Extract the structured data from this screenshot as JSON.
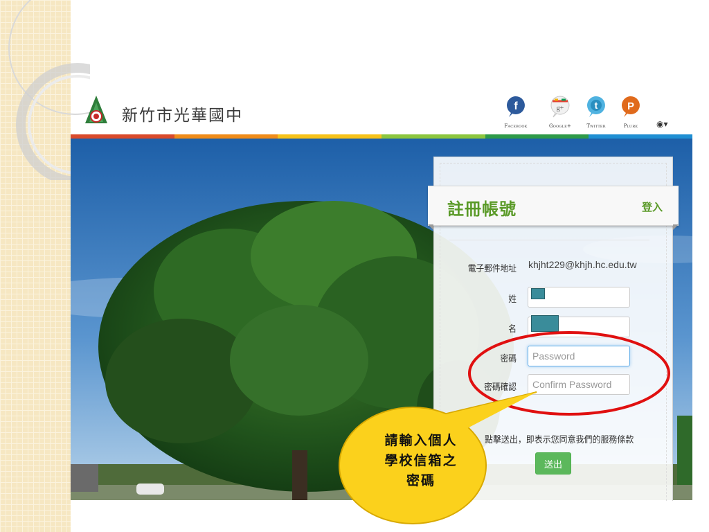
{
  "header": {
    "site_name": "新竹市光華國中",
    "social": [
      {
        "label": "Facebook",
        "icon": "facebook-icon",
        "color": "#2d5a9c",
        "glyph": "f"
      },
      {
        "label": "Google+",
        "icon": "google-plus-icon",
        "color": "#ffffff",
        "glyph": "g+"
      },
      {
        "label": "Twitter",
        "icon": "twitter-icon",
        "color": "#4fb2e0",
        "glyph": "t"
      },
      {
        "label": "Plurk",
        "icon": "plurk-icon",
        "color": "#e06a1c",
        "glyph": "P"
      }
    ],
    "language_icon": "globe-icon"
  },
  "colors": {
    "rainbow": [
      "#d94a2b",
      "#f08c1a",
      "#f6c21a",
      "#8cc63e",
      "#2e9a48",
      "#1f8fd3"
    ],
    "brand_green": "#5a9a28",
    "submit_green": "#5cb85c",
    "callout_fill": "#fbd11c",
    "highlight_ring": "#e01010"
  },
  "form": {
    "title": "註冊帳號",
    "login_link": "登入",
    "email_label": "電子郵件地址",
    "email_value": "khjht229@khjh.hc.edu.tw",
    "surname_label": "姓",
    "givenname_label": "名",
    "password_label": "密碼",
    "password_placeholder": "Password",
    "confirm_label": "密碼確認",
    "confirm_placeholder": "Confirm Password",
    "terms_text": "點擊送出，即表示您同意我們的服務條款",
    "submit_label": "送出"
  },
  "callout": {
    "lines": [
      "請輸入個人",
      "學校信箱之",
      "密碼"
    ]
  }
}
